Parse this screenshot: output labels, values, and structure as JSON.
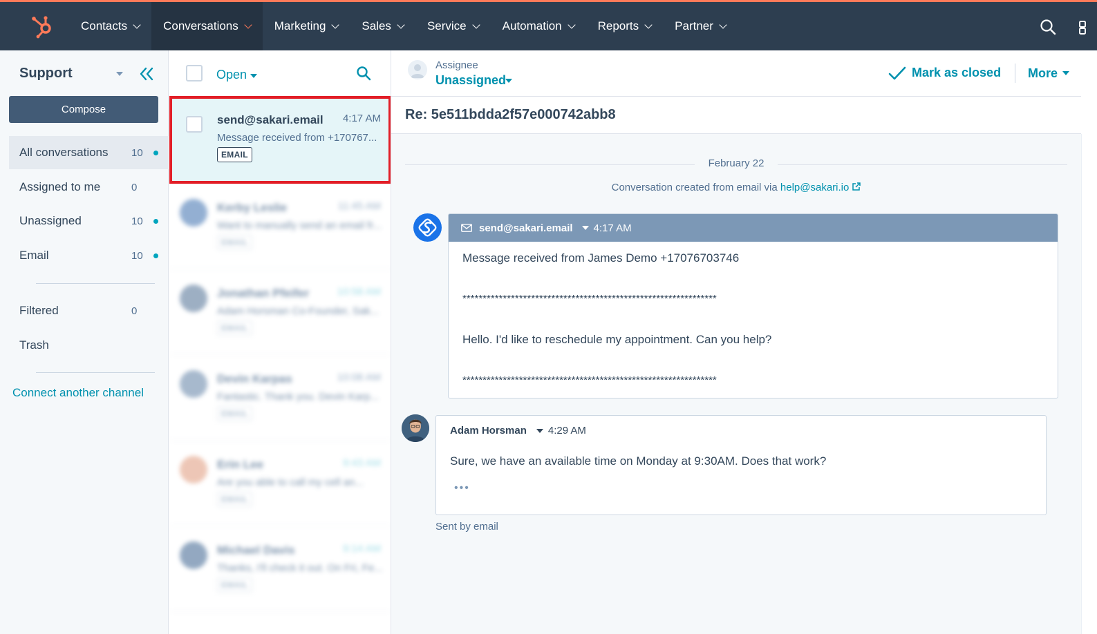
{
  "nav": {
    "items": [
      {
        "label": "Contacts"
      },
      {
        "label": "Conversations"
      },
      {
        "label": "Marketing"
      },
      {
        "label": "Sales"
      },
      {
        "label": "Service"
      },
      {
        "label": "Automation"
      },
      {
        "label": "Reports"
      },
      {
        "label": "Partner"
      }
    ],
    "active": "Conversations",
    "accent": "#ff7a59",
    "background": "#2d3e50"
  },
  "sidebar": {
    "inbox_name": "Support",
    "compose_label": "Compose",
    "items": [
      {
        "label": "All conversations",
        "count": "10",
        "unread": true
      },
      {
        "label": "Assigned to me",
        "count": "0",
        "unread": false
      },
      {
        "label": "Unassigned",
        "count": "10",
        "unread": true
      },
      {
        "label": "Email",
        "count": "10",
        "unread": true
      },
      {
        "label": "Filtered",
        "count": "0",
        "unread": false
      },
      {
        "label": "Trash",
        "count": "",
        "unread": false
      }
    ],
    "connect_label": "Connect another channel"
  },
  "list": {
    "filter_label": "Open",
    "selected": {
      "from": "send@sakari.email",
      "time": "4:17 AM",
      "preview": "Message received from +170767...",
      "badge": "EMAIL"
    },
    "blurred": [
      {
        "from": "Kerby Leslie",
        "time": "11:45 AM",
        "preview": "Want to manually send an email fr...",
        "badge": "EMAIL"
      },
      {
        "from": "Jonathan Pfeifer",
        "time": "10:58 AM",
        "preview": "Adam Horsman Co-Founder, Sak...",
        "badge": "EMAIL"
      },
      {
        "from": "Devin Karpas",
        "time": "10:08 AM",
        "preview": "Fantastic. Thank you. Devin Karp...",
        "badge": "EMAIL"
      },
      {
        "from": "Erin Lee",
        "time": "9:43 AM",
        "preview": "Are you able to call my cell an...",
        "badge": "EMAIL"
      },
      {
        "from": "Michael Davis",
        "time": "9:14 AM",
        "preview": "Thanks, I'll check it out. On Fri, Fe...",
        "badge": "EMAIL"
      }
    ]
  },
  "thread": {
    "assignee_label": "Assignee",
    "assignee_value": "Unassigned",
    "mark_closed_label": "Mark as closed",
    "more_label": "More",
    "subject": "Re: 5e511bdda2f57e000742abb8",
    "date": "February 22",
    "created_note_prefix": "Conversation created from email via ",
    "created_note_link": "help@sakari.io",
    "email": {
      "sender": "send@sakari.email",
      "time": "4:17 AM",
      "line1": "Message received from James Demo +17076703746",
      "stars1": "***************************************************************",
      "line2": "Hello. I'd like to reschedule my appointment.  Can you help?",
      "stars2": "***************************************************************"
    },
    "reply": {
      "name": "Adam Horsman",
      "time": "4:29 AM",
      "body": "Sure, we have an available time on Monday at 9:30AM. Does that work?",
      "dots": "•••",
      "sent_by": "Sent by email"
    }
  },
  "icons": {
    "logo": "hubspot-sprocket-icon",
    "search": "search-icon",
    "collapse": "double-chevron-left-icon",
    "check": "checkmark-icon",
    "mail": "envelope-icon",
    "external": "external-link-icon"
  }
}
